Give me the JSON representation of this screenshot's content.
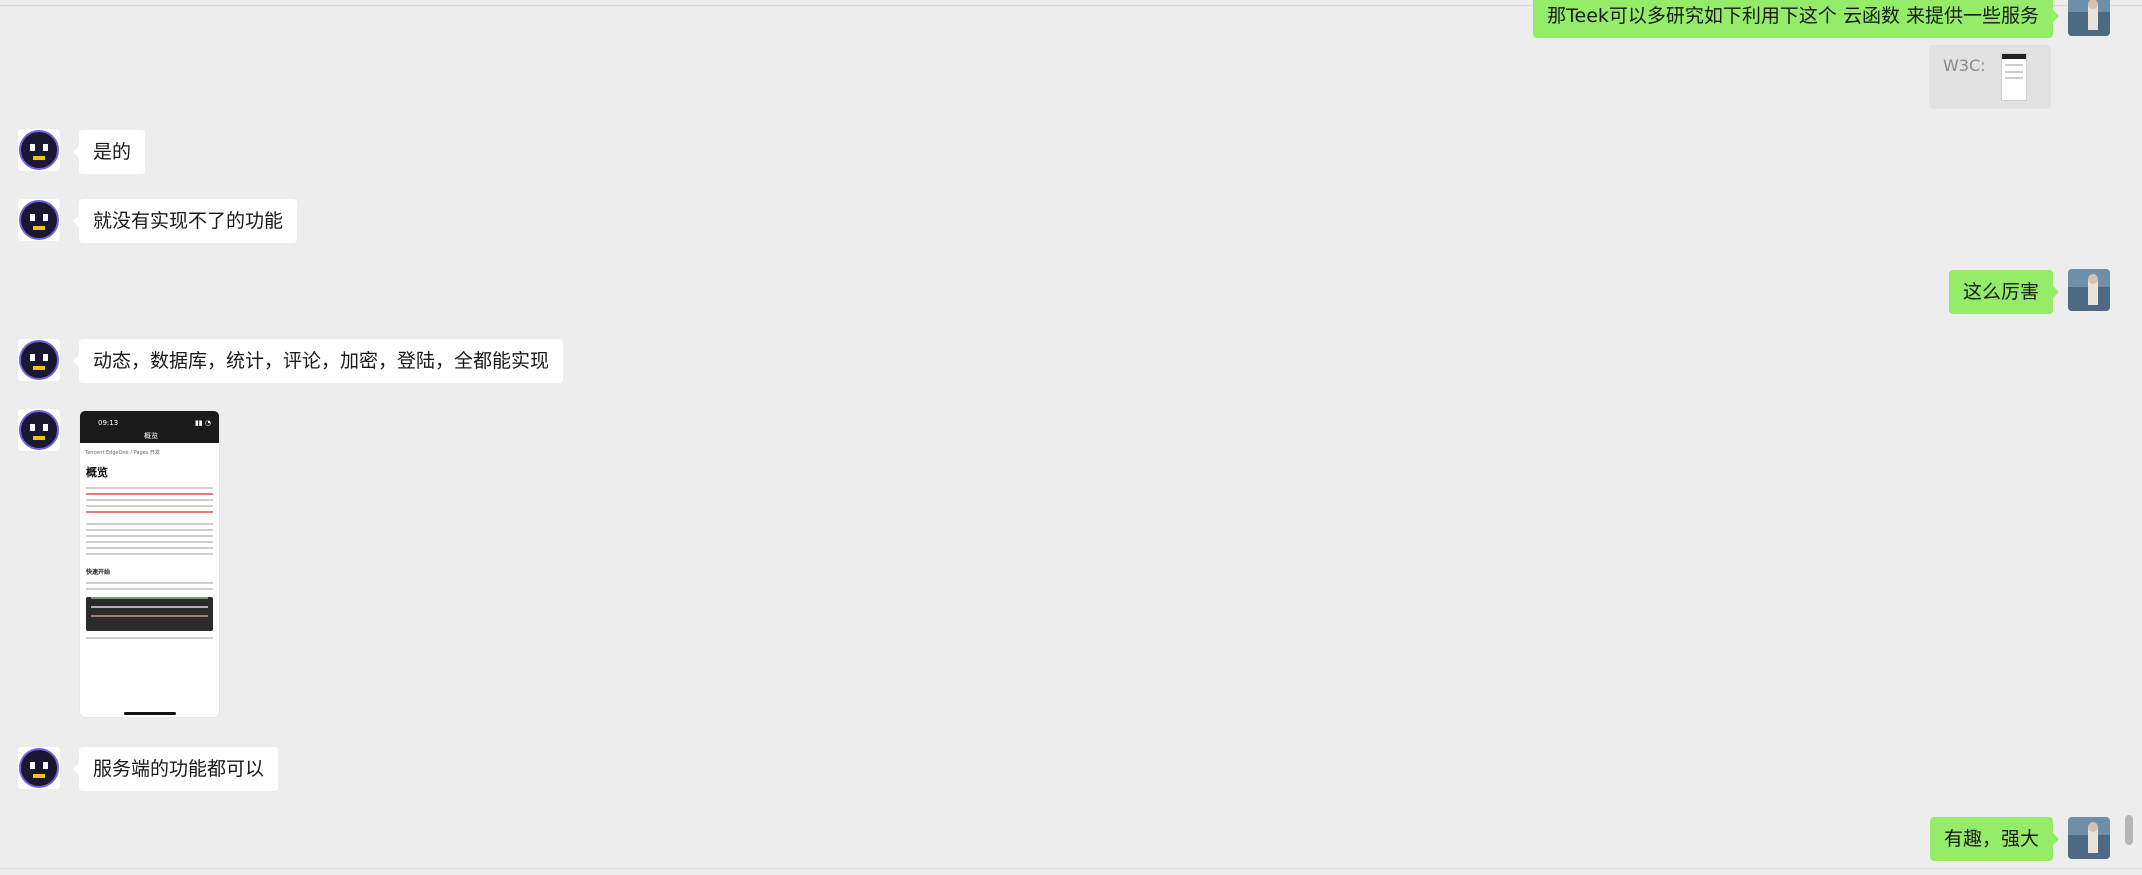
{
  "messages": [
    {
      "side": "right",
      "text": "那Teek可以多研究如下利用下这个 云函数 来提供一些服务"
    },
    {
      "side": "right",
      "kind": "quote",
      "label": "W3C:"
    },
    {
      "side": "left",
      "text": "是的"
    },
    {
      "side": "left",
      "text": "就没有实现不了的功能"
    },
    {
      "side": "right",
      "text": "这么厉害"
    },
    {
      "side": "left",
      "text": "动态，数据库，统计，评论，加密，登陆，全都能实现"
    },
    {
      "side": "left",
      "kind": "image",
      "time": "09:13",
      "title": "概览",
      "crumb": "Tencent EdgeOne  /  Pages 开发",
      "heading": "概览",
      "subheading": "快速开始"
    },
    {
      "side": "left",
      "text": "服务端的功能都可以"
    },
    {
      "side": "right",
      "text": "有趣，强大"
    }
  ],
  "colors": {
    "background": "#ededed",
    "left_bubble": "#ffffff",
    "right_bubble": "#95ec69"
  },
  "icons": {
    "contact_avatar": "robot-face-icon",
    "self_avatar": "landscape-photo-avatar"
  }
}
